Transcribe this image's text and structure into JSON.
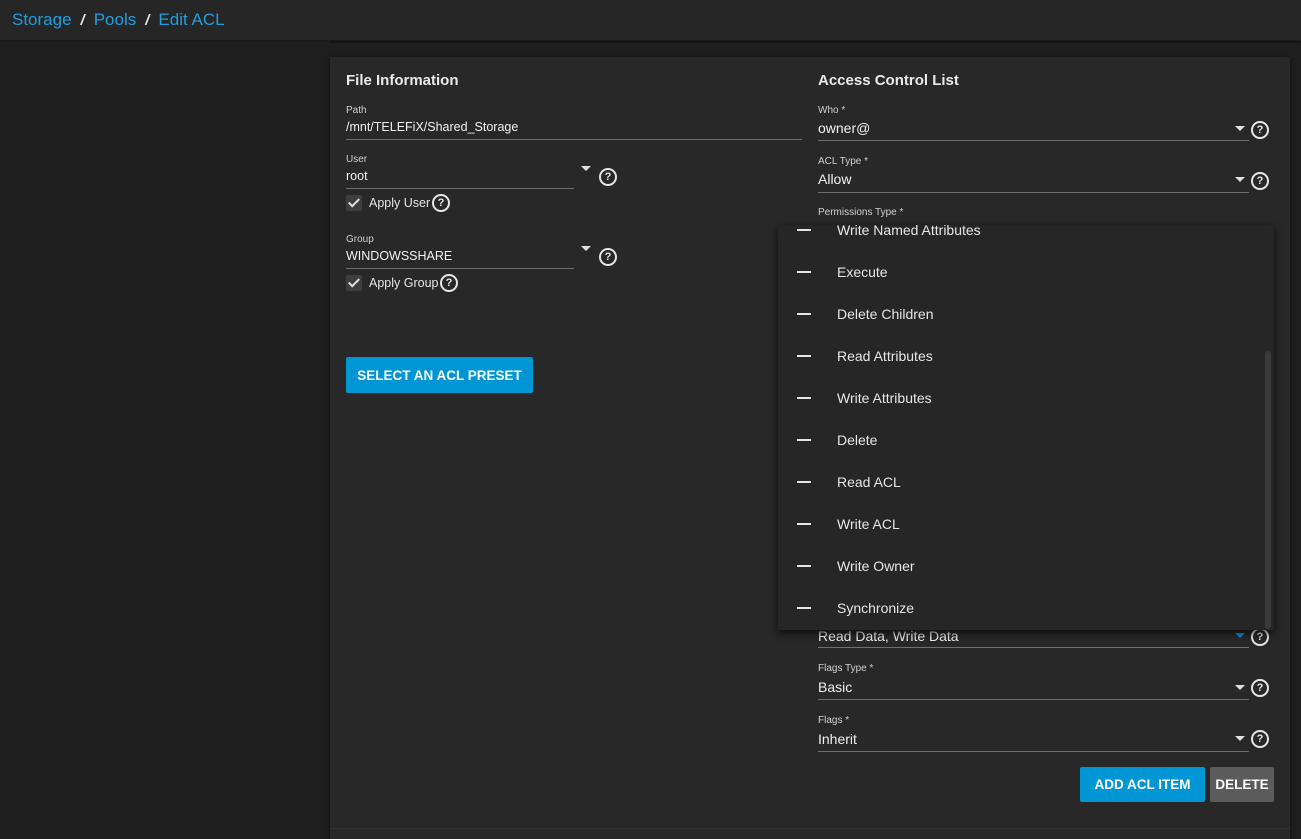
{
  "breadcrumb": {
    "items": [
      "Storage",
      "Pools",
      "Edit ACL"
    ],
    "separator": "/"
  },
  "file_information": {
    "title": "File Information",
    "path": {
      "label": "Path",
      "value": "/mnt/TELEFiX/Shared_Storage"
    },
    "user": {
      "label": "User",
      "value": "root",
      "apply_label": "Apply User",
      "apply_checked": true
    },
    "group": {
      "label": "Group",
      "value": "WINDOWSSHARE",
      "apply_label": "Apply Group",
      "apply_checked": true
    },
    "preset_button": "SELECT AN ACL PRESET"
  },
  "acl": {
    "title": "Access Control List",
    "who": {
      "label": "Who *",
      "value": "owner@"
    },
    "acl_type": {
      "label": "ACL Type *",
      "value": "Allow"
    },
    "permissions_type": {
      "label": "Permissions Type *"
    },
    "permissions": {
      "value": "Read Data, Write Data"
    },
    "flags_type": {
      "label": "Flags Type *",
      "value": "Basic"
    },
    "flags": {
      "label": "Flags *",
      "value": "Inherit"
    },
    "add_button": "ADD ACL ITEM",
    "delete_button": "DELETE"
  },
  "permissions_dropdown": {
    "items": [
      "Write Named Attributes",
      "Execute",
      "Delete Children",
      "Read Attributes",
      "Write Attributes",
      "Delete",
      "Read ACL",
      "Write ACL",
      "Write Owner",
      "Synchronize"
    ]
  },
  "help_glyph": "?",
  "colors": {
    "accent": "#0095d5",
    "link": "#1e9fe0",
    "background": "#1e1e1e",
    "card": "#282828"
  }
}
